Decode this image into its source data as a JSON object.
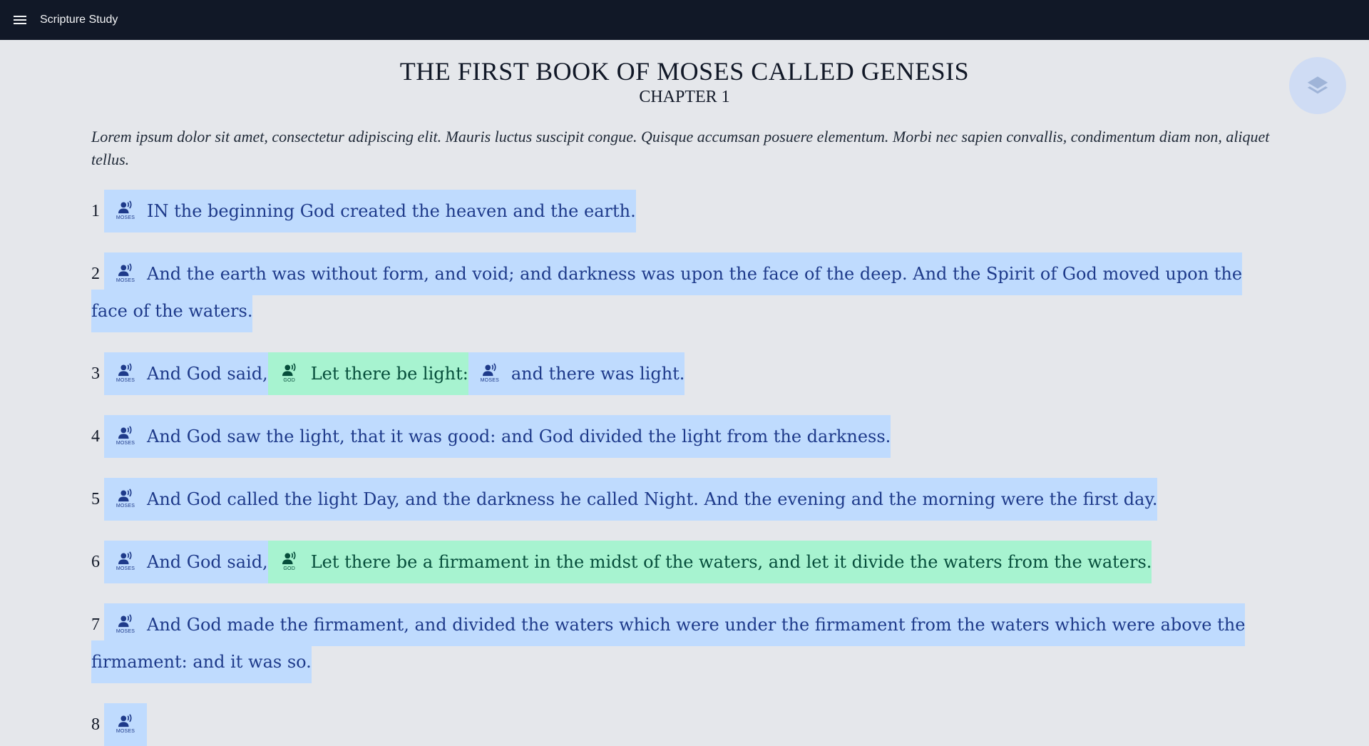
{
  "app": {
    "title": "Scripture Study",
    "menu_icon": "hamburger-menu-icon",
    "layers_icon": "layers-icon"
  },
  "book": {
    "title": "THE FIRST BOOK OF MOSES CALLED GENESIS",
    "chapter": "CHAPTER 1",
    "intro": "Lorem ipsum dolor sit amet, consectetur adipiscing elit. Mauris luctus suscipit congue. Quisque accumsan posuere elementum. Morbi nec sapien convallis, condimentum diam non, aliquet tellus."
  },
  "colors": {
    "topbar": "#111827",
    "moses_highlight": "#bfdbfe",
    "god_highlight": "#a7f3d0",
    "background": "#e5e7eb"
  },
  "verses": [
    {
      "num": "1",
      "segments": [
        {
          "speaker": "MOSES",
          "text": "IN the beginning God created the heaven and the earth."
        }
      ]
    },
    {
      "num": "2",
      "segments": [
        {
          "speaker": "MOSES",
          "text": "And the earth was without form, and void; and darkness was upon the face of the deep. And the Spirit of God moved upon the face of the waters."
        }
      ]
    },
    {
      "num": "3",
      "segments": [
        {
          "speaker": "MOSES",
          "text": "And God said,"
        },
        {
          "speaker": "GOD",
          "text": "Let there be light:"
        },
        {
          "speaker": "MOSES",
          "text": "and there was light."
        }
      ]
    },
    {
      "num": "4",
      "segments": [
        {
          "speaker": "MOSES",
          "text": "And God saw the light, that it was good: and God divided the light from the darkness."
        }
      ]
    },
    {
      "num": "5",
      "segments": [
        {
          "speaker": "MOSES",
          "text": "And God called the light Day, and the darkness he called Night. And the evening and the morning were the first day."
        }
      ]
    },
    {
      "num": "6",
      "segments": [
        {
          "speaker": "MOSES",
          "text": "And God said,"
        },
        {
          "speaker": "GOD",
          "text": "Let there be a firmament in the midst of the waters, and let it divide the waters from the waters."
        }
      ]
    },
    {
      "num": "7",
      "segments": [
        {
          "speaker": "MOSES",
          "text": "And God made the firmament, and divided the waters which were under the firmament from the waters which were above the firmament: and it was so."
        }
      ]
    },
    {
      "num": "8",
      "segments": [
        {
          "speaker": "MOSES",
          "text": ""
        }
      ]
    }
  ]
}
